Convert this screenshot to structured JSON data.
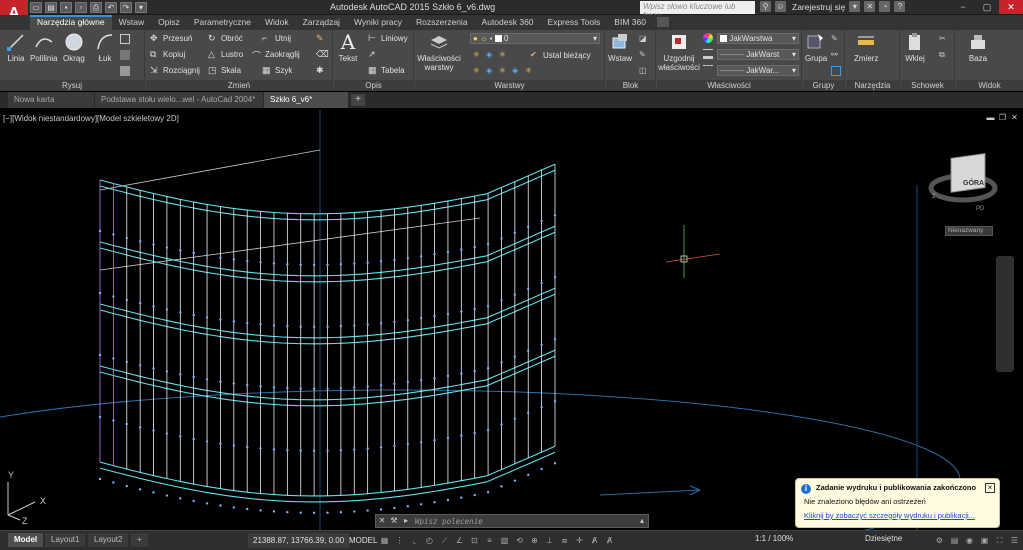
{
  "app": {
    "title": "Autodesk AutoCAD 2015    Szkło 6_v6.dwg",
    "logo_letter": "A",
    "search_placeholder": "Wpisz słowo kluczowe lub frazę",
    "signin": "Zarejestruj się",
    "accent": "#c5252a"
  },
  "ribbon_tabs": [
    "Narzędzia główne",
    "Wstaw",
    "Opisz",
    "Parametryczne",
    "Widok",
    "Zarządzaj",
    "Wyniki pracy",
    "Rozszerzenia",
    "Autodesk 360",
    "Express Tools",
    "BIM 360"
  ],
  "panels": {
    "draw": {
      "title": "Rysuj",
      "buttons": [
        "Linia",
        "Polilinia",
        "Okrąg",
        "Łuk"
      ]
    },
    "modify": {
      "title": "Zmień",
      "items": [
        "Przesuń",
        "Obróć",
        "Utnij",
        "Kopiuj",
        "Lustro",
        "Zaokrąglij",
        "Rozciągnij",
        "Skala",
        "Szyk"
      ]
    },
    "annotation": {
      "title": "Opis",
      "text_button": "Tekst",
      "items": [
        "Liniowy",
        "Tabela"
      ]
    },
    "layers": {
      "title": "Warstwy",
      "props_button": "Właściwości warstwy",
      "layer_value": "0",
      "set_current": "Ustal bieżący"
    },
    "block": {
      "title": "Blok",
      "insert": "Wstaw"
    },
    "properties": {
      "title": "Właściwości",
      "match": "Uzgodnij właściwości",
      "combos": [
        "JakWarstwa",
        "JakWarst",
        "JakWar..."
      ]
    },
    "groups": {
      "title": "Grupy",
      "button": "Grupa"
    },
    "utilities": {
      "title": "Narzędzia",
      "button": "Zmierz"
    },
    "clipboard": {
      "title": "Schowek",
      "button": "Wklej"
    },
    "view": {
      "title": "Widok",
      "button": "Baza"
    }
  },
  "doc_tabs": [
    "Nowa karta",
    "Podstawa stołu wielo...wel - AutoCad 2004*",
    "Szkło 6_v6*"
  ],
  "viewport": {
    "label": "[−][Widok niestandardowy][Model szkieletowy 2D]",
    "viewcube_face": "GÓRA",
    "viewcube_dirs": [
      "Z",
      "PD"
    ],
    "unnamed": "Nienazwany",
    "axis_x": "X",
    "axis_y": "Y",
    "axis_z": "Z"
  },
  "notification": {
    "title": "Zadanie wydruku i publikowania zakończono",
    "line": "Nie znaleziono błędów ani ostrzeżeń",
    "link": "Kliknij by zobaczyć szczegóły wydruku i publikacji...",
    "close": "×"
  },
  "command": {
    "placeholder": "Wpisz polecenie"
  },
  "statusbar": {
    "layout_tabs": [
      "Model",
      "Layout1",
      "Layout2"
    ],
    "coords": "21388.87, 13766.39, 0.00",
    "model": "MODEL",
    "scale": "1:1 / 100%",
    "units": "Dziesiętne"
  }
}
